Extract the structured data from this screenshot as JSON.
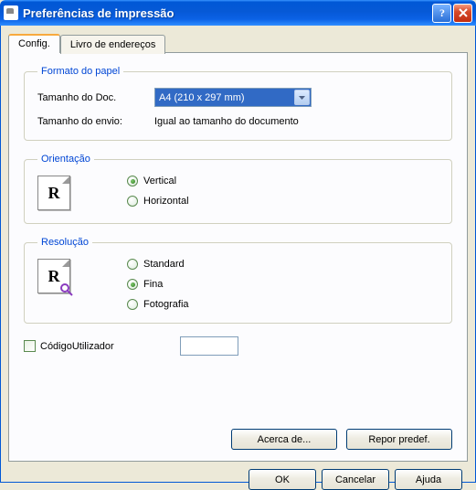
{
  "window": {
    "title": "Preferências de impressão"
  },
  "tabs": {
    "config": "Config.",
    "addressbook": "Livro de endereços"
  },
  "paper": {
    "legend": "Formato do papel",
    "doc_size_label": "Tamanho do Doc.",
    "doc_size_value": "A4 (210 x 297 mm)",
    "send_size_label": "Tamanho do envio:",
    "send_size_value": "Igual ao tamanho do documento"
  },
  "orientation": {
    "legend": "Orientação",
    "vertical": "Vertical",
    "horizontal": "Horizontal",
    "selected": "vertical",
    "preview_letter": "R"
  },
  "resolution": {
    "legend": "Resolução",
    "standard": "Standard",
    "fine": "Fina",
    "photo": "Fotografia",
    "selected": "fine",
    "preview_letter": "R"
  },
  "usercode": {
    "label": "CódigoUtilizador",
    "value": ""
  },
  "buttons": {
    "about": "Acerca de...",
    "restore": "Repor predef.",
    "ok": "OK",
    "cancel": "Cancelar",
    "help": "Ajuda"
  }
}
